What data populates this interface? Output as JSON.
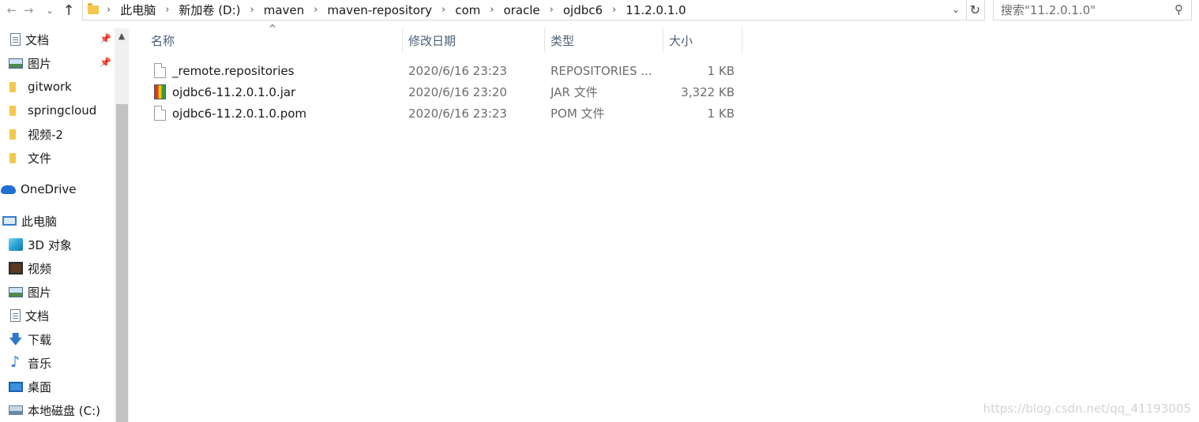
{
  "window": {
    "nav": {
      "back_icon": "arrow-left-icon",
      "forward_icon": "arrow-right-icon",
      "recent_icon": "chevron-down-icon",
      "up_icon": "arrow-up-icon"
    },
    "breadcrumbs": [
      "此电脑",
      "新加卷 (D:)",
      "maven",
      "maven-repository",
      "com",
      "oracle",
      "ojdbc6",
      "11.2.0.1.0"
    ],
    "search_placeholder": "搜索\"11.2.0.1.0\""
  },
  "sidebar": {
    "items": [
      {
        "label": "文档",
        "icon": "document-icon",
        "pinned": true
      },
      {
        "label": "图片",
        "icon": "picture-icon",
        "pinned": true
      },
      {
        "label": "gitwork",
        "icon": "folder-icon"
      },
      {
        "label": "springcloud",
        "icon": "folder-icon"
      },
      {
        "label": "视频-2",
        "icon": "folder-icon"
      },
      {
        "label": "文件",
        "icon": "folder-icon"
      },
      {
        "label": "OneDrive",
        "icon": "onedrive-icon"
      },
      {
        "label": "此电脑",
        "icon": "this-pc-icon"
      },
      {
        "label": "3D 对象",
        "icon": "3d-objects-icon"
      },
      {
        "label": "视频",
        "icon": "video-icon"
      },
      {
        "label": "图片",
        "icon": "picture-icon"
      },
      {
        "label": "文档",
        "icon": "document-icon"
      },
      {
        "label": "下载",
        "icon": "download-icon"
      },
      {
        "label": "音乐",
        "icon": "music-icon"
      },
      {
        "label": "桌面",
        "icon": "desktop-icon"
      },
      {
        "label": "本地磁盘 (C:)",
        "icon": "drive-icon"
      }
    ]
  },
  "columns": {
    "name": "名称",
    "date": "修改日期",
    "type": "类型",
    "size": "大小"
  },
  "files": [
    {
      "name": "_remote.repositories",
      "date": "2020/6/16 23:23",
      "type": "REPOSITORIES ...",
      "size": "1 KB",
      "icon": "file-icon"
    },
    {
      "name": "ojdbc6-11.2.0.1.0.jar",
      "date": "2020/6/16 23:20",
      "type": "JAR 文件",
      "size": "3,322 KB",
      "icon": "jar-file-icon"
    },
    {
      "name": "ojdbc6-11.2.0.1.0.pom",
      "date": "2020/6/16 23:23",
      "type": "POM 文件",
      "size": "1 KB",
      "icon": "file-icon"
    }
  ],
  "watermark": "https://blog.csdn.net/qq_41193005"
}
